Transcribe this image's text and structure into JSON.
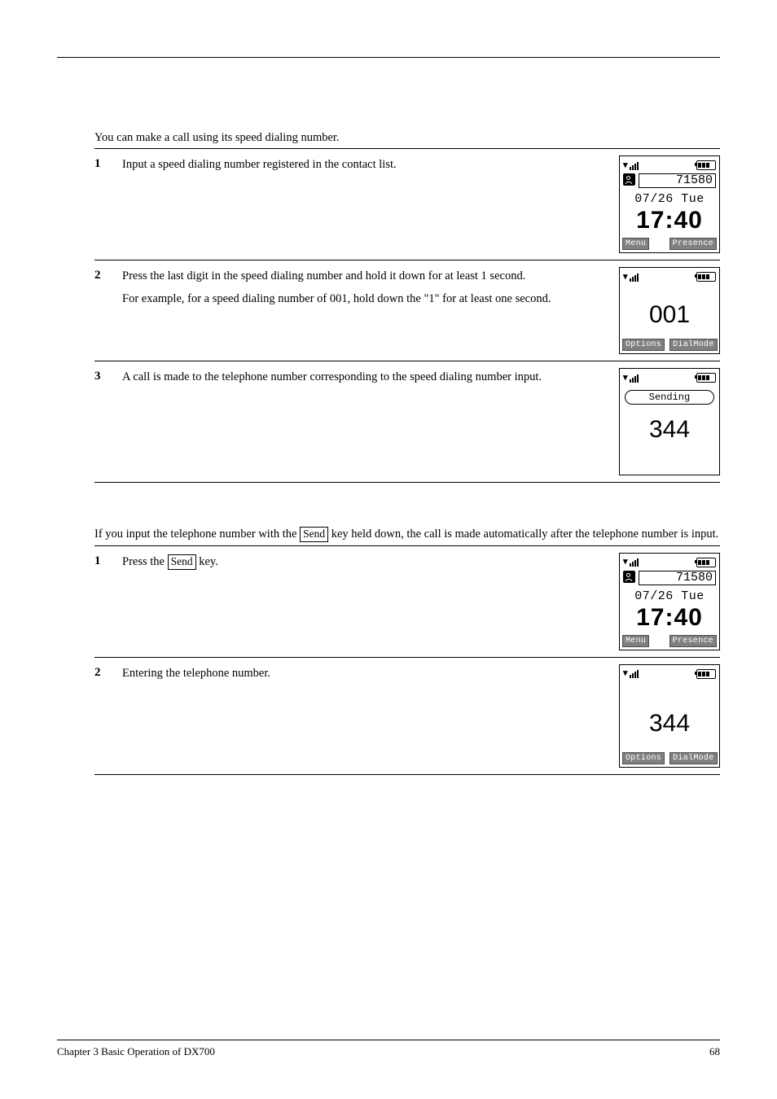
{
  "section1": {
    "intro": "You can make a call using its speed dialing number.",
    "steps": [
      {
        "num": "1",
        "paras": [
          "Input a speed dialing number registered in the contact list."
        ],
        "screen": {
          "type": "home",
          "ext": "71580",
          "date": "07/26 Tue",
          "time": "17:40",
          "soft_left": "Menu",
          "soft_right": "Presence"
        }
      },
      {
        "num": "2",
        "paras": [
          "Press the last digit in the speed dialing number and hold it down for at least 1 second.",
          "For example, for a speed dialing number of 001, hold down the \"1\" for at least one second."
        ],
        "screen": {
          "type": "dial",
          "big": "001",
          "soft_left": "Options",
          "soft_right": "DialMode"
        }
      },
      {
        "num": "3",
        "paras": [
          "A call is made to the telephone number corresponding to the speed dialing number input."
        ],
        "screen": {
          "type": "calling",
          "status": "Sending",
          "big": "344"
        }
      }
    ]
  },
  "section2": {
    "intro_pre": "If you input the telephone number with the ",
    "intro_key": "Send",
    "intro_post": " key held down, the call is made automatically after the telephone number is input.",
    "steps": [
      {
        "num": "1",
        "text_pre": "Press the ",
        "text_key": "Send",
        "text_post": " key.",
        "screen": {
          "type": "home",
          "ext": "71580",
          "date": "07/26 Tue",
          "time": "17:40",
          "soft_left": "Menu",
          "soft_right": "Presence"
        }
      },
      {
        "num": "2",
        "text": "Entering the telephone number.",
        "screen": {
          "type": "dial",
          "big": "344",
          "soft_left": "Options",
          "soft_right": "DialMode"
        }
      }
    ]
  },
  "footer": {
    "left": "Chapter 3 Basic Operation of DX700",
    "right": "68"
  }
}
